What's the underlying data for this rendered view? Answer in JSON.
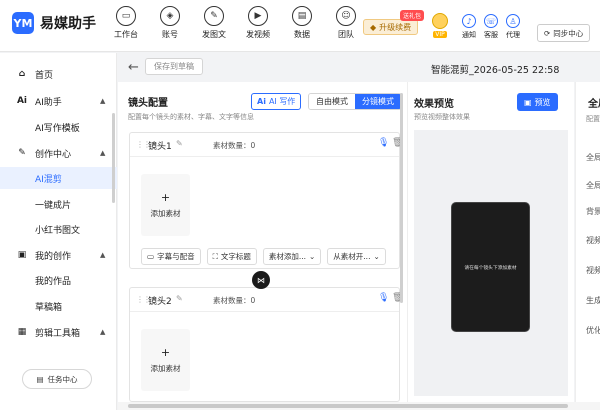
{
  "app": {
    "name": "易媒助手",
    "logo_text": "YM"
  },
  "topnav": [
    {
      "label": "工作台",
      "icon": "tv-icon",
      "glyph": "▭"
    },
    {
      "label": "账号",
      "icon": "account-icon",
      "glyph": "◈"
    },
    {
      "label": "发图文",
      "icon": "pen-icon",
      "glyph": "✎"
    },
    {
      "label": "发视频",
      "icon": "video-icon",
      "glyph": "▶"
    },
    {
      "label": "数据",
      "icon": "data-icon",
      "glyph": "▤"
    },
    {
      "label": "团队",
      "icon": "team-icon",
      "glyph": "☺"
    }
  ],
  "upgrade": {
    "label": "升级续费",
    "gift": "送礼包"
  },
  "vip_label": "VIP",
  "topright": [
    {
      "label": "通知",
      "icon": "bell-icon",
      "glyph": "♪"
    },
    {
      "label": "客服",
      "icon": "support-icon",
      "glyph": "☏"
    },
    {
      "label": "代理",
      "icon": "agent-icon",
      "glyph": "♙"
    }
  ],
  "sync_label": "同步中心",
  "sidebar": {
    "items": [
      {
        "label": "首页",
        "icon": "home-icon",
        "glyph": "⌂",
        "type": "main"
      },
      {
        "label": "AI助手",
        "icon": "ai-icon",
        "glyph": "Ai",
        "type": "main",
        "chevron": "▲"
      },
      {
        "label": "AI写作模板",
        "type": "sub"
      },
      {
        "label": "创作中心",
        "icon": "create-icon",
        "glyph": "✎",
        "type": "main",
        "chevron": "▲"
      },
      {
        "label": "AI混剪",
        "type": "sub",
        "active": true
      },
      {
        "label": "一键成片",
        "type": "sub"
      },
      {
        "label": "小红书图文",
        "type": "sub"
      },
      {
        "label": "我的创作",
        "icon": "works-icon",
        "glyph": "▣",
        "type": "main",
        "chevron": "▲"
      },
      {
        "label": "我的作品",
        "type": "sub"
      },
      {
        "label": "草稿箱",
        "type": "sub"
      },
      {
        "label": "剪辑工具箱",
        "icon": "toolbox-icon",
        "glyph": "▦",
        "type": "main",
        "chevron": "▲"
      }
    ],
    "task_center": "任务中心"
  },
  "toolbar": {
    "save_draft": "保存到草稿",
    "doc_title": "智能混剪_2026-05-25 22:58"
  },
  "clip_config": {
    "title": "镜头配置",
    "subtitle": "配置每个镜头的素材、字幕、文字等信息",
    "ai_write": "AI 写作",
    "modes": [
      {
        "label": "自由模式",
        "active": false
      },
      {
        "label": "分镜模式",
        "active": true
      }
    ],
    "clips": [
      {
        "name": "镜头1",
        "material_count": "素材数量：0"
      },
      {
        "name": "镜头2",
        "material_count": "素材数量：0"
      }
    ],
    "add_material": "添加素材",
    "actions": {
      "subtitle_dub": "字幕与配音",
      "text_title": "文字标题",
      "source_add": "素材添加...",
      "from_source": "从素材开..."
    }
  },
  "preview": {
    "title": "效果预览",
    "subtitle": "预览视频整体效果",
    "button": "预览",
    "phone_text": "请在每个镜头下添加素材"
  },
  "right_panel": {
    "title": "全局",
    "items": [
      "配置",
      "全局",
      "全局",
      "背景",
      "视频",
      "视频",
      "生成",
      "优化"
    ]
  }
}
